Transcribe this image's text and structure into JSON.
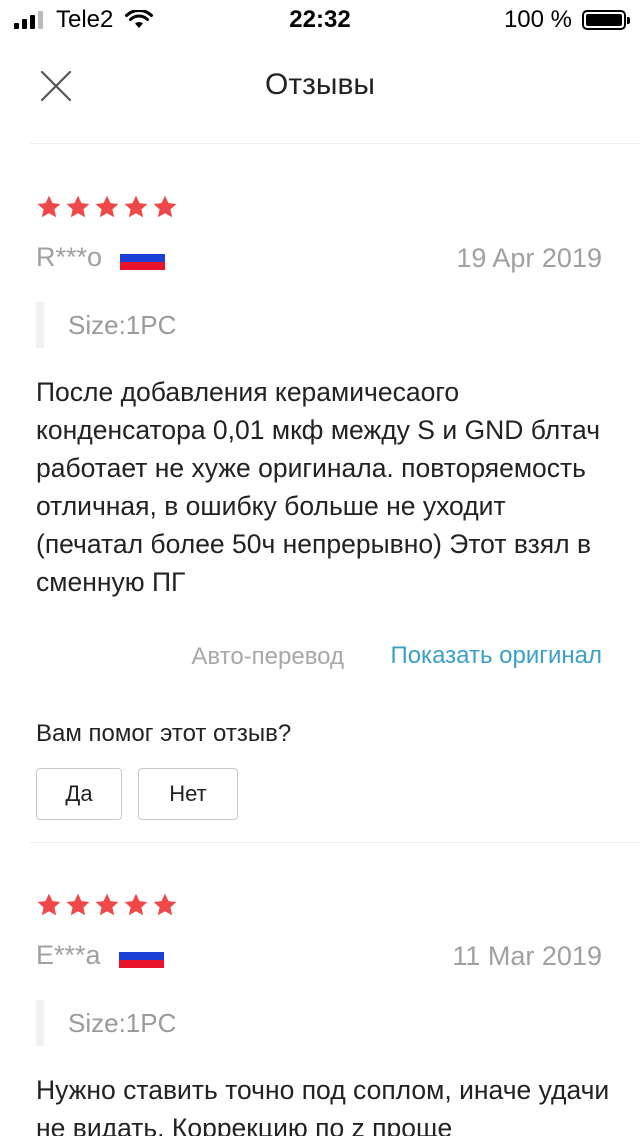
{
  "status_bar": {
    "carrier": "Tele2",
    "time": "22:32",
    "battery": "100 %",
    "signal_bars_filled": 3,
    "signal_bars_total": 4
  },
  "header": {
    "title": "Отзывы",
    "close_icon": "close-icon"
  },
  "colors": {
    "star": "#f04848",
    "link": "#3a9fc9",
    "muted": "#a0a0a0",
    "flag": [
      "#ffffff",
      "#1c3fd6",
      "#e8132b"
    ]
  },
  "reviews": [
    {
      "rating": 5,
      "author": "R***o",
      "country_flag": "russia-flag",
      "date": "19 Apr 2019",
      "sku": "Size:1PC",
      "text": "После добавления керамичесаого конденсатора 0,01 мкф между S и GND блтач работает не хуже оригинала. повторяемость отличная, в ошибку больше не уходит (печатал более 50ч непрерывно) Этот взял в сменную ПГ",
      "auto_translate": "Авто-перевод",
      "show_original": "Показать оригинал",
      "helpful_question": "Вам помог этот отзыв?",
      "yes": "Да",
      "no": "Нет"
    },
    {
      "rating": 5,
      "author": "E***a",
      "country_flag": "russia-flag",
      "date": "11 Mar 2019",
      "sku": "Size:1PC",
      "text": "Нужно ставить точно под соплом, иначе удачи не видать. Коррекцию по z проще"
    }
  ]
}
